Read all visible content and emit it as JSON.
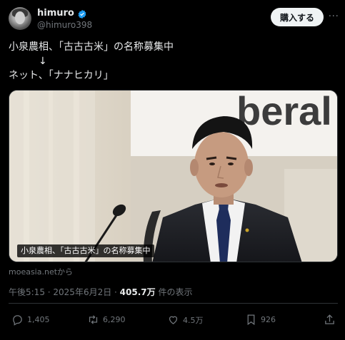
{
  "author": {
    "display_name": "himuro",
    "handle": "@himuro398",
    "verified_icon": "verified-badge-icon",
    "verified_color": "#1d9bf0"
  },
  "header": {
    "buy_label": "購入する",
    "more_label": "···"
  },
  "tweet": {
    "lines": [
      "小泉農相、「古古古米」の名称募集中",
      "　　　↓",
      "ネット、「ナナヒカリ」"
    ]
  },
  "media": {
    "caption": "小泉農相、「古古古米」の名称募集中",
    "backdrop_text": "beral"
  },
  "source": "moeasia.netから",
  "meta": {
    "time": "午後5:15",
    "separator": " · ",
    "date": "2025年6月2日",
    "views_count": "405.7万",
    "views_label": " 件の表示"
  },
  "actions": {
    "reply_count": "1,405",
    "retweet_count": "6,290",
    "like_count": "4.5万",
    "bookmark_count": "926"
  },
  "colors": {
    "background": "#000000",
    "text": "#e7e9ea",
    "muted": "#71767b",
    "border": "#2f3336",
    "buy_button_bg": "#eff3f4"
  }
}
